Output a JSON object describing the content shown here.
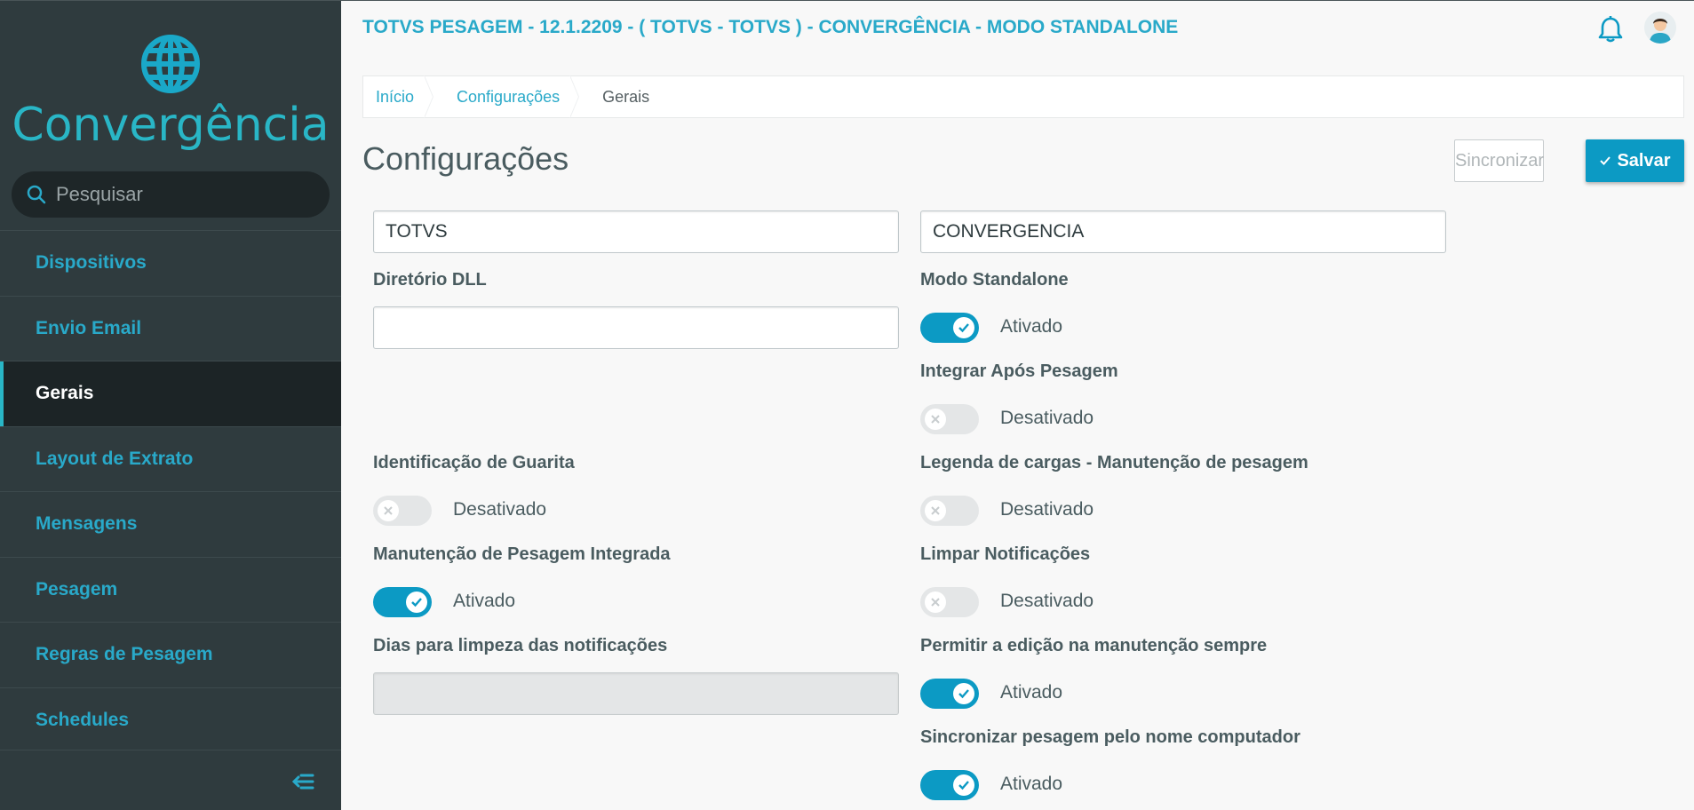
{
  "sidebar": {
    "logo_text": "Convergência",
    "search_placeholder": "Pesquisar",
    "items": [
      {
        "label": "Dispositivos",
        "active": false
      },
      {
        "label": "Envio Email",
        "active": false
      },
      {
        "label": "Gerais",
        "active": true
      },
      {
        "label": "Layout de Extrato",
        "active": false
      },
      {
        "label": "Mensagens",
        "active": false
      },
      {
        "label": "Pesagem",
        "active": false
      },
      {
        "label": "Regras de Pesagem",
        "active": false
      },
      {
        "label": "Schedules",
        "active": false
      }
    ]
  },
  "header": {
    "title": "TOTVS PESAGEM - 12.1.2209 - ( TOTVS - TOTVS ) - CONVERGÊNCIA - MODO STANDALONE",
    "icons": [
      "bell-icon",
      "user-avatar"
    ]
  },
  "breadcrumb": [
    "Início",
    "Configurações",
    "Gerais"
  ],
  "page": {
    "title": "Configurações",
    "sync_label": "Sincronizar",
    "save_label": "Salvar"
  },
  "form": {
    "field1_value": "TOTVS",
    "field2_value": "CONVERGENCIA",
    "dll_label": "Diretório DLL",
    "dll_value": "",
    "standalone_label": "Modo Standalone",
    "standalone_state": "Ativado",
    "integrar_label": "Integrar Após Pesagem",
    "integrar_state": "Desativado",
    "guarita_label": "Identificação de Guarita",
    "guarita_state": "Desativado",
    "legenda_label": "Legenda de cargas - Manutenção de pesagem",
    "legenda_state": "Desativado",
    "manutencao_label": "Manutenção de Pesagem Integrada",
    "manutencao_state": "Ativado",
    "limpar_label": "Limpar Notificações",
    "limpar_state": "Desativado",
    "dias_label": "Dias para limpeza das notificações",
    "dias_value": "",
    "permitir_label": "Permitir a edição na manutenção sempre",
    "permitir_state": "Ativado",
    "sincronizar_label": "Sincronizar pesagem pelo nome computador",
    "sincronizar_state": "Ativado"
  },
  "colors": {
    "accent": "#29a9c9",
    "primary_button": "#0c9ac4",
    "sidebar_bg": "#2f3b3e"
  }
}
